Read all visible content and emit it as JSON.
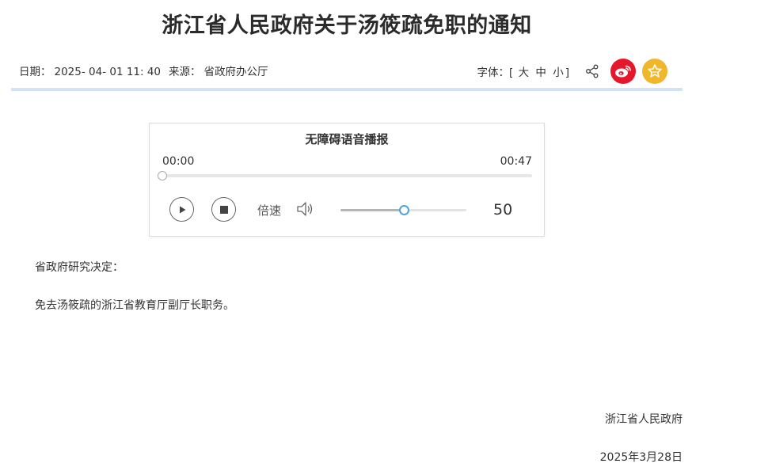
{
  "article": {
    "title": "浙江省人民政府关于汤筱疏免职的通知",
    "meta": {
      "date_label": "日期：",
      "date_value": "2025- 04- 01 11: 40",
      "source_label": "来源：",
      "source_value": "省政府办公厅"
    },
    "font_size": {
      "label": "字体：[",
      "large": "大",
      "medium": "中",
      "small": "小",
      "close": "]"
    },
    "body": [
      "省政府研究决定：",
      "免去汤筱疏的浙江省教育厅副厅长职务。"
    ],
    "signature": {
      "org": "浙江省人民政府",
      "date": "2025年3月28日"
    }
  },
  "player": {
    "title": "无障碍语音播报",
    "current_time": "00:00",
    "total_time": "00:47",
    "progress": 0.0,
    "speed_label": "倍速",
    "volume": 50,
    "volume_max": 100
  },
  "icons": {
    "share": "share-icon",
    "weibo": "weibo-icon",
    "favorite": "star-icon",
    "play": "play-icon",
    "stop": "stop-icon",
    "volume": "speaker-icon"
  },
  "colors": {
    "weibo": "#e6162d",
    "favorite": "#f1b72c",
    "divider": "#d3e3f6",
    "volume_knob": "#4da3e0"
  }
}
